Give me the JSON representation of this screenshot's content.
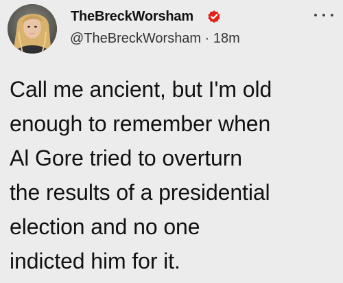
{
  "tweet": {
    "display_name": "TheBreckWorsham",
    "handle": "@TheBreckWorsham",
    "separator": "·",
    "time": "18m",
    "text_lines": [
      "Call me ancient, but I'm old",
      "enough to remember when",
      "Al Gore tried to overturn",
      "the results of a presidential",
      "election and no one",
      "indicted him for it."
    ]
  },
  "icons": {
    "avatar": "profile-photo",
    "verified": "verified-badge-icon",
    "more": "more-options-icon"
  },
  "colors": {
    "background": "#ececec",
    "verified_badge": "#e2231a",
    "text": "#111111"
  }
}
